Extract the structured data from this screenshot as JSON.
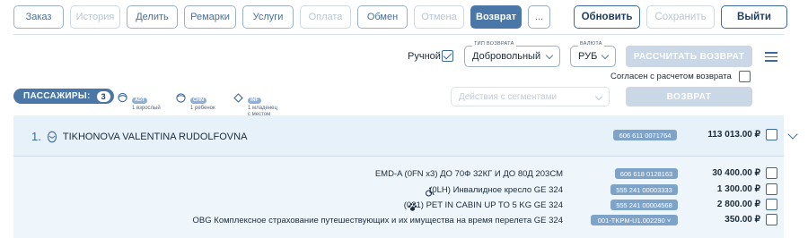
{
  "toolbar": {
    "buttons": [
      "Заказ",
      "История",
      "Делить",
      "Ремарки",
      "Услуги",
      "Оплата",
      "Обмен",
      "Отмена",
      "Возврат",
      "..."
    ],
    "right": [
      "Обновить",
      "Сохранить",
      "Выйти"
    ]
  },
  "controls": {
    "manual_label": "Ручной",
    "return_type": {
      "caption": "ТИП ВОЗВРАТА",
      "value": "Добровольный"
    },
    "currency": {
      "caption": "ВАЛЮТА",
      "value": "РУБ"
    },
    "calc_button": "РАССЧИТАТЬ ВОЗВРАТ",
    "agree_label": "Согласен с расчетом возврата",
    "segments_placeholder": "Действия с сегментами",
    "return_button": "ВОЗВРАТ"
  },
  "passengers": {
    "label": "ПАССАЖИРЫ:",
    "count": "3",
    "types": [
      {
        "code": "ADT",
        "desc": "1 взрослый"
      },
      {
        "code": "CHN",
        "desc": "1 ребенок"
      },
      {
        "code": "INF",
        "desc1": "1 младенец",
        "desc2": "с местом"
      }
    ]
  },
  "passenger": {
    "number": "1.",
    "name": "TIKHONOVA VALENTINA RUDOLFOVNA",
    "ticket": "606 611 0071764",
    "total": "113 013.00 ₽"
  },
  "services": [
    {
      "text": "EMD-A  (0FN x3)  ДО 70Ф 32КГ И ДО 80Д 203СМ",
      "badge": "606 618 0128163",
      "amount": "30 400.00 ₽"
    },
    {
      "text": "(0LH)  Инвалидное кресло  GE 324",
      "icon": "wheelchair-icon",
      "badge": "555 241 00003333",
      "amount": "1 300.00 ₽"
    },
    {
      "text": "(021)  PET IN CABIN UP TO 5 KG  GE 324",
      "icon": "paw-icon",
      "badge": "555 241 00004568",
      "amount": "2 800.00 ₽"
    },
    {
      "text": "OBG  Комплексное страхование путешествующих и их имущества на время перелета  GE 324",
      "badge": "001-TKPM-U1.002290 ˅",
      "amount": "350.00 ₽"
    }
  ],
  "colors": {
    "primary": "#4a77a8",
    "badge": "#7ea3c9",
    "panel": "#e6f1fa"
  }
}
